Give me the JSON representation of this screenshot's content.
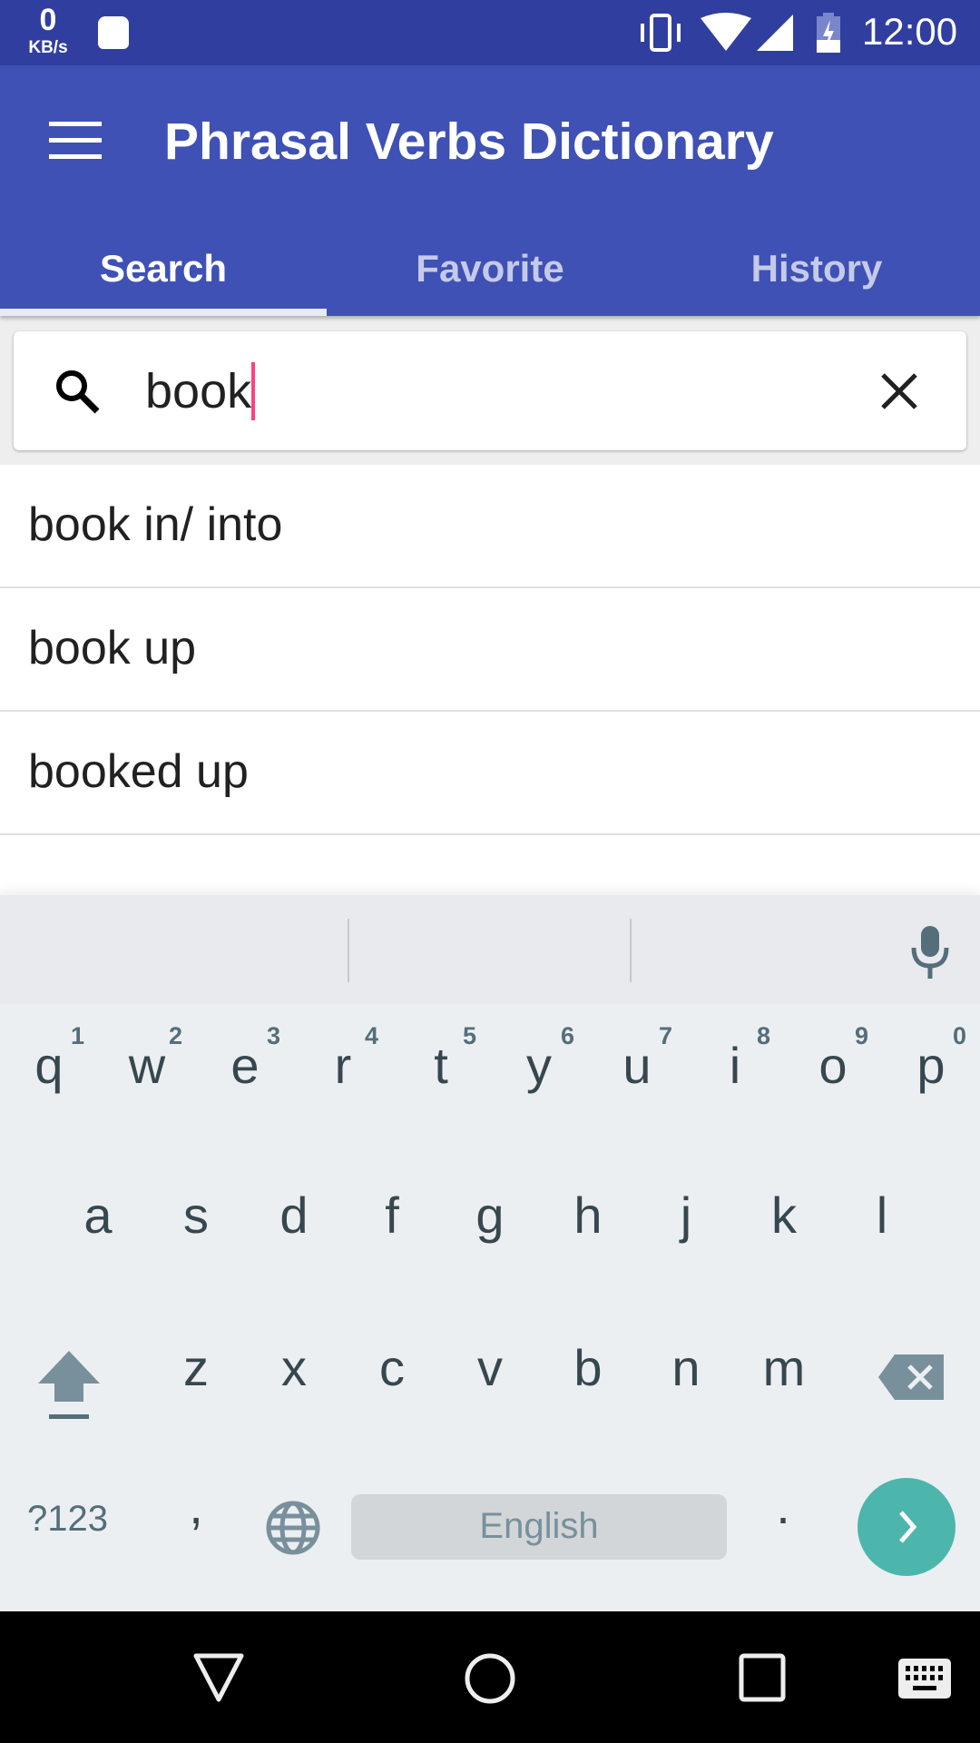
{
  "status": {
    "speed_value": "0",
    "speed_unit": "KB/s",
    "time": "12:00"
  },
  "appbar": {
    "title": "Phrasal Verbs Dictionary"
  },
  "tabs": [
    {
      "label": "Search",
      "active": true
    },
    {
      "label": "Favorite",
      "active": false
    },
    {
      "label": "History",
      "active": false
    }
  ],
  "search": {
    "value": "book",
    "placeholder": ""
  },
  "results": [
    "book in/ into",
    "book up",
    "booked up"
  ],
  "keyboard": {
    "row1": [
      "q",
      "w",
      "e",
      "r",
      "t",
      "y",
      "u",
      "i",
      "o",
      "p"
    ],
    "hints": [
      "1",
      "2",
      "3",
      "4",
      "5",
      "6",
      "7",
      "8",
      "9",
      "0"
    ],
    "row2": [
      "a",
      "s",
      "d",
      "f",
      "g",
      "h",
      "j",
      "k",
      "l"
    ],
    "row3": [
      "z",
      "x",
      "c",
      "v",
      "b",
      "n",
      "m"
    ],
    "symbols_label": "?123",
    "comma": ",",
    "period": ".",
    "space_label": "English"
  },
  "colors": {
    "primary": "#3F51B5",
    "primary_dark": "#303F9F",
    "accent": "#4DB6AC",
    "cursor": "#FF4081"
  }
}
